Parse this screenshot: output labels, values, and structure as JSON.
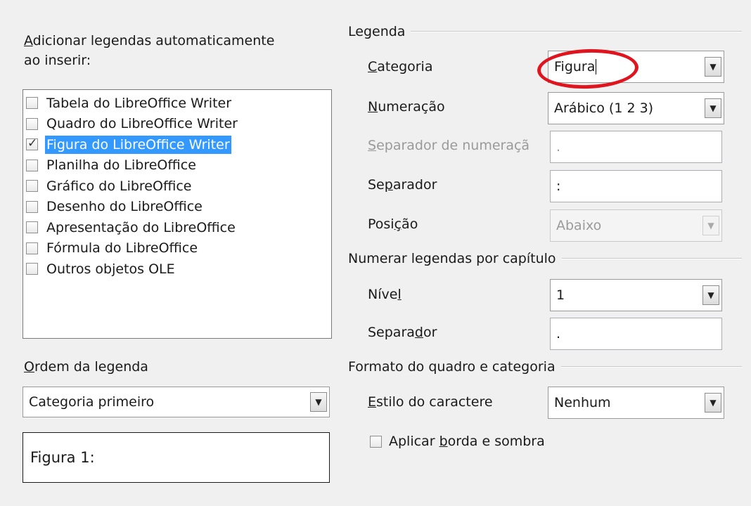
{
  "left": {
    "auto_caption_label_prefix": "",
    "auto_caption_label_line1_u": "A",
    "auto_caption_label_line1_rest": "dicionar legendas automaticamente",
    "auto_caption_label_line2": "ao inserir:",
    "objects": [
      {
        "label": "Tabela do LibreOffice Writer",
        "checked": false,
        "selected": false
      },
      {
        "label": "Quadro do LibreOffice Writer",
        "checked": false,
        "selected": false
      },
      {
        "label": "Figura do LibreOffice Writer",
        "checked": true,
        "selected": true
      },
      {
        "label": "Planilha do LibreOffice",
        "checked": false,
        "selected": false
      },
      {
        "label": "Gráfico do LibreOffice",
        "checked": false,
        "selected": false
      },
      {
        "label": "Desenho do LibreOffice",
        "checked": false,
        "selected": false
      },
      {
        "label": "Apresentação do LibreOffice",
        "checked": false,
        "selected": false
      },
      {
        "label": "Fórmula do LibreOffice",
        "checked": false,
        "selected": false
      },
      {
        "label": "Outros objetos OLE",
        "checked": false,
        "selected": false
      }
    ],
    "order_label_u": "O",
    "order_label_rest": "rdem da legenda",
    "order_value": "Categoria primeiro",
    "preview_text": "Figura 1:"
  },
  "caption": {
    "group_title": "Legenda",
    "category_label_u": "C",
    "category_label_rest": "ategoria",
    "category_value": "Figura",
    "numbering_label_u": "N",
    "numbering_label_rest": "umeração",
    "numbering_value": "Arábico (1 2 3)",
    "numsep_label_u": "S",
    "numsep_label_rest": "eparador de numeraçã",
    "numsep_value": ".",
    "separator_label_pre": "Se",
    "separator_label_u": "p",
    "separator_label_rest": "arador",
    "separator_value": ":",
    "position_label_pre": "Posi",
    "position_label_u": "ç",
    "position_label_rest": "ão",
    "position_value": "Abaixo"
  },
  "chapter": {
    "group_title": "Numerar legendas por capítulo",
    "level_label_pre": "Níve",
    "level_label_u": "l",
    "level_value": "1",
    "separator_label_pre": "Separa",
    "separator_label_u": "d",
    "separator_label_rest": "or",
    "separator_value": "."
  },
  "format": {
    "group_title": "Formato do quadro e categoria",
    "char_style_label_u": "E",
    "char_style_label_rest": "stilo do caractere",
    "char_style_value": "Nenhum",
    "border_label_pre": "Aplicar ",
    "border_label_u": "b",
    "border_label_rest": "orda e sombra",
    "border_checked": false
  },
  "icons": {
    "dropdown": "▼"
  },
  "colors": {
    "selection": "#3399ff",
    "highlight_ring": "#e0141e"
  }
}
